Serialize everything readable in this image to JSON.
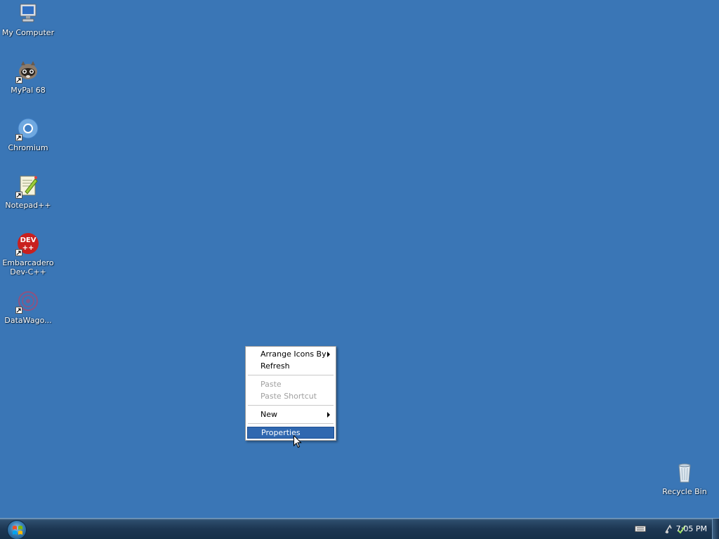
{
  "desktop": {
    "background_color": "#3a76b6",
    "icons": [
      {
        "label": "My Computer",
        "icon": "computer-icon",
        "shortcut": false
      },
      {
        "label": "MyPal 68",
        "icon": "mypal-icon",
        "shortcut": true
      },
      {
        "label": "Chromium",
        "icon": "chromium-icon",
        "shortcut": true
      },
      {
        "label": "Notepad++",
        "icon": "notepad-plus-plus-icon",
        "shortcut": true
      },
      {
        "label": "Embarcadero\nDev-C++",
        "icon": "dev-cpp-icon",
        "shortcut": true
      },
      {
        "label": "DataWago...",
        "icon": "datawagon-icon",
        "shortcut": true
      },
      {
        "label": "Recycle Bin",
        "icon": "recycle-bin-icon",
        "shortcut": false
      }
    ]
  },
  "context_menu": {
    "items": [
      {
        "label": "Arrange Icons By",
        "enabled": true,
        "submenu": true
      },
      {
        "label": "Refresh",
        "enabled": true,
        "submenu": false
      },
      {
        "label": "Paste",
        "enabled": false,
        "submenu": false
      },
      {
        "label": "Paste Shortcut",
        "enabled": false,
        "submenu": false
      },
      {
        "label": "New",
        "enabled": true,
        "submenu": true
      },
      {
        "label": "Properties",
        "enabled": true,
        "submenu": false,
        "selected": true
      }
    ],
    "highlight_color": "#3068b0"
  },
  "taskbar": {
    "start_icon": "windows-orb-icon",
    "tray_icons": [
      "keyboard-icon",
      "network-icon",
      "volume-icon"
    ],
    "clock": "7:05 PM"
  }
}
